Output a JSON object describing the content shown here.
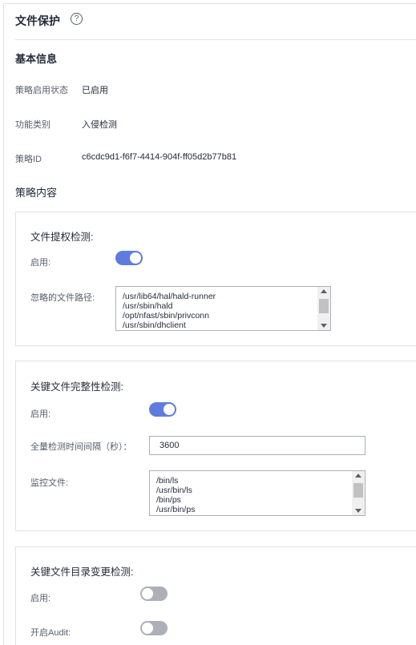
{
  "header": {
    "title": "文件保护",
    "help_icon": "?"
  },
  "basic_info": {
    "section_title": "基本信息",
    "rows": [
      {
        "label": "策略启用状态",
        "value": "已启用"
      },
      {
        "label": "功能类别",
        "value": "入侵检测"
      },
      {
        "label": "策略ID",
        "value": "c6cdc9d1-f6f7-4414-904f-ff05d2b77b81"
      }
    ]
  },
  "policy_content": {
    "section_title": "策略内容"
  },
  "panel1": {
    "title": "文件提权检测:",
    "enable_label": "启用:",
    "enable_state": true,
    "ignore_label": "忽略的文件路径:",
    "ignore_paths": "/usr/lib64/hal/hald-runner\n/usr/sbin/hald\n/opt/nfast/sbin/privconn\n/usr/sbin/dhclient"
  },
  "panel2": {
    "title": "关键文件完整性检测:",
    "enable_label": "启用:",
    "enable_state": true,
    "interval_label": "全量检测时间间隔（秒）：",
    "interval_value": "3600",
    "monitor_label": "监控文件:",
    "monitor_files": "/bin/ls\n/usr/bin/ls\n/bin/ps\n/usr/bin/ps"
  },
  "panel3": {
    "title": "关键文件目录变更检测:",
    "enable_label": "启用:",
    "enable_state": false,
    "audit_label": "开启Audit:",
    "audit_state": false
  },
  "colors": {
    "toggle_on": "#5e7ce0",
    "toggle_off": "#adb0b8"
  }
}
